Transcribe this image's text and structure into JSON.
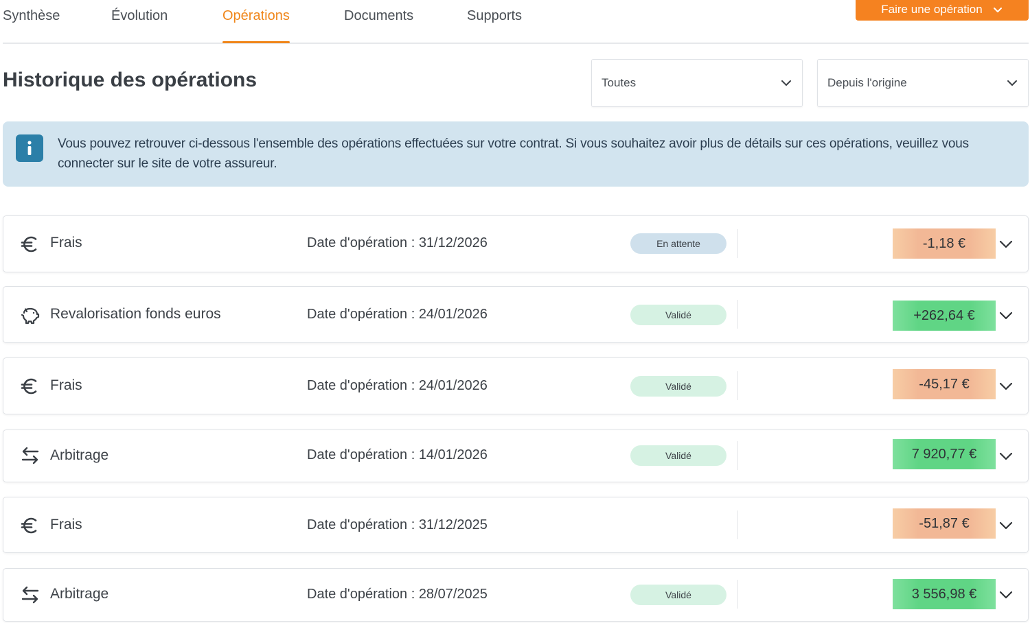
{
  "tabs": [
    {
      "label": "Synthèse",
      "active": false
    },
    {
      "label": "Évolution",
      "active": false
    },
    {
      "label": "Opérations",
      "active": true
    },
    {
      "label": "Documents",
      "active": false
    },
    {
      "label": "Supports",
      "active": false
    }
  ],
  "action_button": {
    "label": "Faire une opération"
  },
  "header": {
    "title": "Historique des opérations",
    "filter_type": "Toutes",
    "filter_period": "Depuis l'origine"
  },
  "info": {
    "text": "Vous pouvez retrouver ci-dessous l'ensemble des opérations effectuées sur votre contrat. Si vous souhaitez avoir plus de détails sur ces opérations, veuillez vous connecter sur le site de votre assureur."
  },
  "operations": [
    {
      "icon": "euro-icon",
      "label": "Frais",
      "date": "Date d'opération : 31/12/2026",
      "status": "En attente",
      "status_type": "pending",
      "amount": "-1,18 €",
      "sign": "negative"
    },
    {
      "icon": "piggy-bank-icon",
      "label": "Revalorisation fonds euros",
      "date": "Date d'opération : 24/01/2026",
      "status": "Validé",
      "status_type": "valid",
      "amount": "+262,64 €",
      "sign": "positive"
    },
    {
      "icon": "euro-icon",
      "label": "Frais",
      "date": "Date d'opération : 24/01/2026",
      "status": "Validé",
      "status_type": "valid",
      "amount": "-45,17 €",
      "sign": "negative"
    },
    {
      "icon": "arrows-swap-icon",
      "label": "Arbitrage",
      "date": "Date d'opération : 14/01/2026",
      "status": "Validé",
      "status_type": "valid",
      "amount": "7 920,77 €",
      "sign": "positive"
    },
    {
      "icon": "euro-icon",
      "label": "Frais",
      "date": "Date d'opération : 31/12/2025",
      "status": "",
      "status_type": "none",
      "amount": "-51,87 €",
      "sign": "negative"
    },
    {
      "icon": "arrows-swap-icon",
      "label": "Arbitrage",
      "date": "Date d'opération : 28/07/2025",
      "status": "Validé",
      "status_type": "valid",
      "amount": "3 556,98 €",
      "sign": "positive"
    }
  ],
  "colors": {
    "accent": "#f0861a",
    "button": "#f58220",
    "info_bg": "#d2e4ef",
    "info_icon": "#2b7fa8",
    "positive": "#60d585",
    "negative": "#f2b896"
  }
}
